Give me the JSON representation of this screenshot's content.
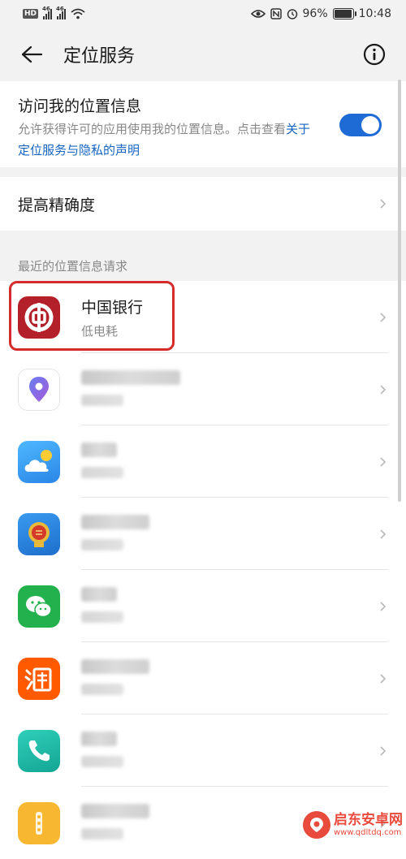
{
  "status_bar": {
    "network": "46",
    "battery": "96%",
    "time": "10:48"
  },
  "header": {
    "title": "定位服务"
  },
  "location_access": {
    "title": "访问我的位置信息",
    "description": "允许获得许可的应用使用我的位置信息。点击查看",
    "link": "关于定位服务与隐私的声明",
    "enabled": true
  },
  "accuracy": {
    "label": "提高精确度"
  },
  "recent": {
    "header": "最近的位置信息请求",
    "apps": [
      {
        "name": "中国银行",
        "sub": "低电耗",
        "icon": "bank-of-china-icon",
        "color": "#b3202a"
      },
      {
        "name": "",
        "sub": "",
        "icon": "map-pin-icon",
        "color": "#ffffff"
      },
      {
        "name": "",
        "sub": "",
        "icon": "weather-icon",
        "color": "#3aa0f0"
      },
      {
        "name": "",
        "sub": "",
        "icon": "tax-emblem-icon",
        "color": "#2c7fd6"
      },
      {
        "name": "",
        "sub": "",
        "icon": "wechat-icon",
        "color": "#22b14c"
      },
      {
        "name": "",
        "sub": "",
        "icon": "taobao-icon",
        "color": "#ff5a00"
      },
      {
        "name": "",
        "sub": "",
        "icon": "phone-icon",
        "color": "#1fb8a8"
      },
      {
        "name": "",
        "sub": "",
        "icon": "file-manager-icon",
        "color": "#f7b731"
      }
    ]
  },
  "watermark": {
    "title": "启东安卓网",
    "url": "www.qdltdq.com"
  }
}
